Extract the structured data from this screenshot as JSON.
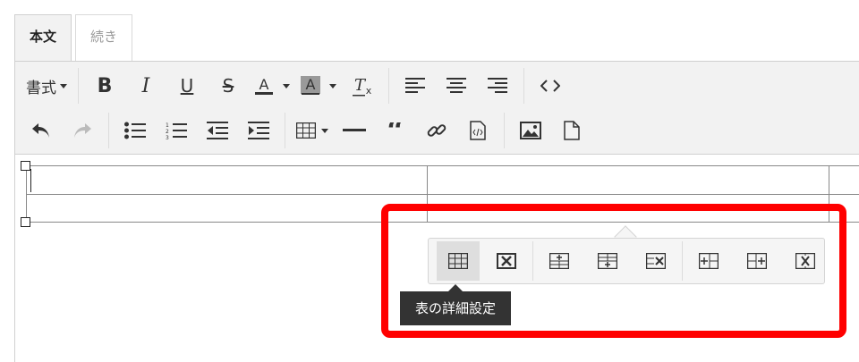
{
  "tabs": [
    {
      "label": "本文",
      "active": true
    },
    {
      "label": "続き",
      "active": false
    }
  ],
  "toolbar": {
    "format_label": "書式",
    "row1_icons": [
      "bold-icon",
      "italic-icon",
      "underline-icon",
      "strikethrough-icon",
      "text-color-icon",
      "background-color-icon",
      "clear-formatting-icon",
      "align-left-icon",
      "align-center-icon",
      "align-right-icon",
      "source-code-icon"
    ],
    "row2_icons": [
      "undo-icon",
      "redo-icon",
      "bullet-list-icon",
      "numbered-list-icon",
      "outdent-icon",
      "indent-icon",
      "table-icon",
      "horizontal-rule-icon",
      "blockquote-icon",
      "link-icon",
      "embed-code-icon",
      "image-icon",
      "file-icon"
    ]
  },
  "table_popup": {
    "buttons": [
      "table-properties-icon",
      "delete-table-icon",
      "insert-row-before-icon",
      "insert-row-after-icon",
      "delete-row-icon",
      "insert-column-before-icon",
      "insert-column-after-icon",
      "delete-column-icon"
    ],
    "selected": "table-properties-icon",
    "tooltip": "表の詳細設定"
  },
  "colors": {
    "highlight": "#ff0000",
    "toolbar_bg": "#f2f2f2",
    "tooltip_bg": "#333333"
  }
}
